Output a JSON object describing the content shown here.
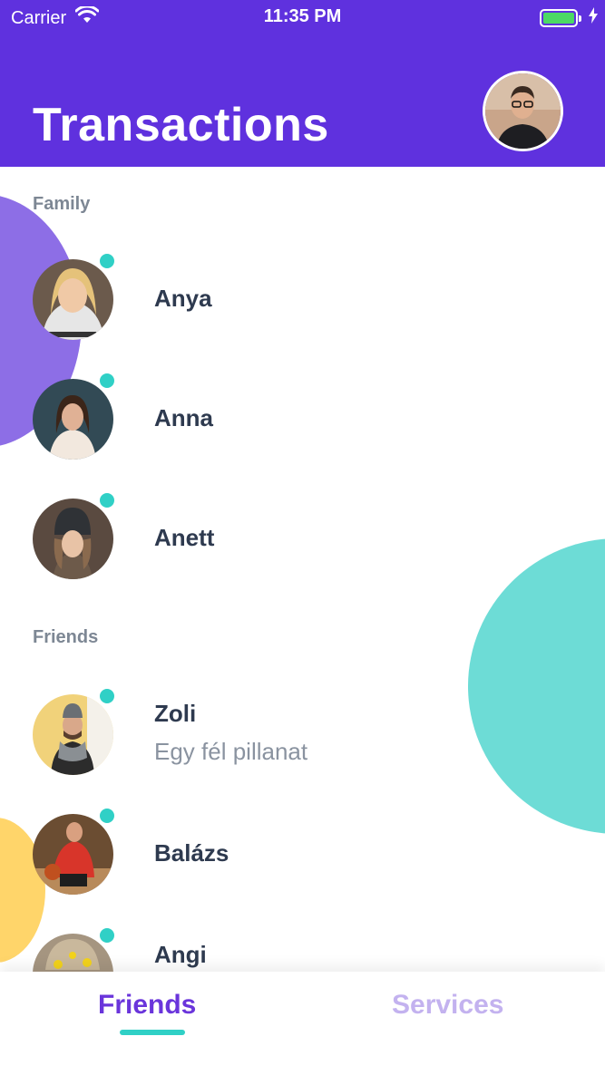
{
  "status_bar": {
    "carrier": "Carrier",
    "time": "11:35 PM",
    "wifi_icon": "wifi-icon",
    "battery_icon": "battery-icon",
    "charging_icon": "bolt-icon"
  },
  "header": {
    "title": "Transactions",
    "profile_avatar_icon": "user-avatar"
  },
  "sections": {
    "family": {
      "title": "Family",
      "contacts": [
        {
          "name": "Anya",
          "online": true
        },
        {
          "name": "Anna",
          "online": true
        },
        {
          "name": "Anett",
          "online": true
        }
      ]
    },
    "friends": {
      "title": "Friends",
      "contacts": [
        {
          "name": "Zoli",
          "subtitle": "Egy fél pillanat",
          "online": true
        },
        {
          "name": "Balázs",
          "online": true
        },
        {
          "name": "Angi",
          "online": true
        }
      ]
    }
  },
  "tabs": {
    "friends": "Friends",
    "services": "Services",
    "active": "Friends"
  },
  "colors": {
    "primary": "#5f31de",
    "accent_teal": "#30d0c6",
    "deco_purple": "#8d6ee6",
    "deco_teal": "#6ddcd6",
    "deco_yellow": "#ffd56a",
    "text_dark": "#2e3a4f",
    "text_muted": "#7d8794"
  }
}
